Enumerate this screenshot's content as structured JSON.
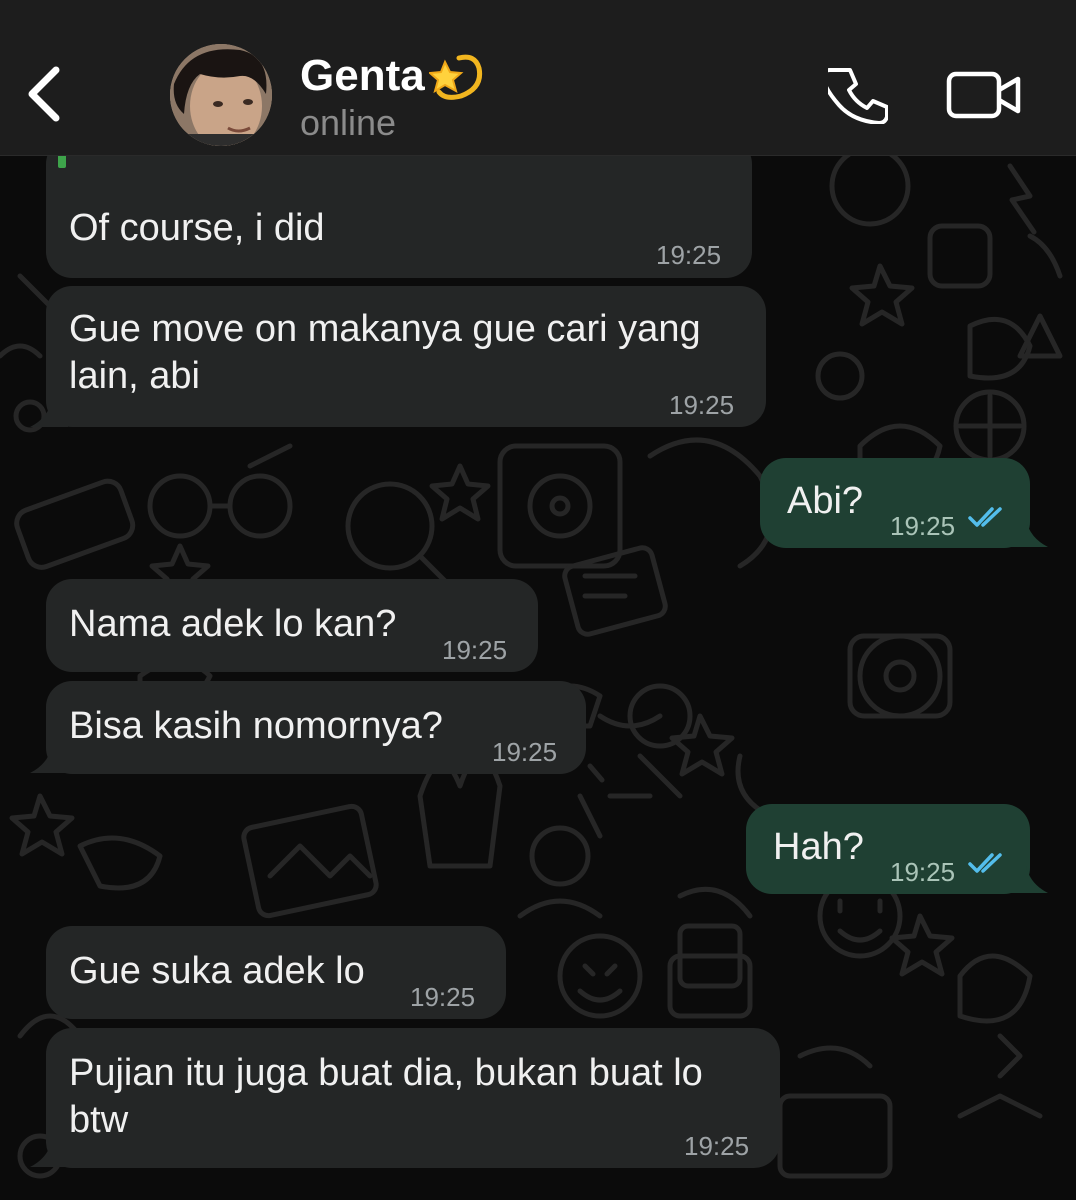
{
  "header": {
    "back_icon": "chevron-left-icon",
    "contact_name": "Genta",
    "name_emoji": "dizzy-star-icon",
    "status": "online",
    "call_icon": "phone-icon",
    "video_icon": "video-camera-icon"
  },
  "messages": [
    {
      "direction": "incoming",
      "text": "Of course, i did",
      "time": "19:25"
    },
    {
      "direction": "incoming",
      "text": "Gue move on makanya gue cari yang lain, abi",
      "time": "19:25"
    },
    {
      "direction": "outgoing",
      "text": "Abi?",
      "time": "19:25",
      "status": "read"
    },
    {
      "direction": "incoming",
      "text": "Nama adek lo kan?",
      "time": "19:25"
    },
    {
      "direction": "incoming",
      "text": "Bisa kasih nomornya?",
      "time": "19:25"
    },
    {
      "direction": "outgoing",
      "text": "Hah?",
      "time": "19:25",
      "status": "read"
    },
    {
      "direction": "incoming",
      "text": "Gue suka adek lo",
      "time": "19:25"
    },
    {
      "direction": "incoming",
      "text": "Pujian itu juga buat dia, bukan buat lo btw",
      "time": "19:25"
    }
  ],
  "colors": {
    "incoming_bubble": "#242626",
    "outgoing_bubble": "#1f4033",
    "read_ticks": "#53bdeb",
    "header_bg": "#1d1d1d"
  }
}
